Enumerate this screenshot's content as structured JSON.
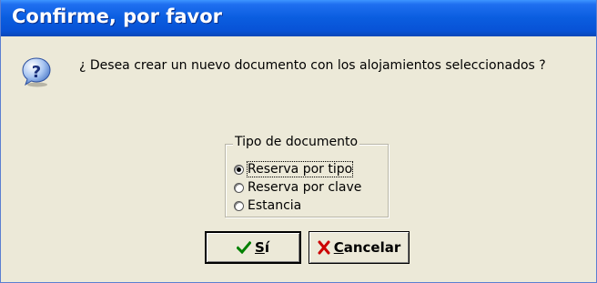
{
  "dialog": {
    "title": "Confirme, por favor",
    "icon": "question-icon",
    "message": "¿ Desea crear un nuevo documento con los alojamientos seleccionados ?"
  },
  "document_type": {
    "legend": "Tipo de documento",
    "options": [
      {
        "label": "Reserva por tipo",
        "selected": true
      },
      {
        "label": "Reserva por clave",
        "selected": false
      },
      {
        "label": "Estancia",
        "selected": false
      }
    ]
  },
  "buttons": {
    "ok": {
      "hotkey": "S",
      "rest": "í",
      "icon": "checkmark-icon",
      "color": "#008000"
    },
    "cancel": {
      "hotkey": "C",
      "rest": "ancelar",
      "icon": "x-icon",
      "color": "#cc0000"
    }
  },
  "colors": {
    "titlebar": "#0a5ddf",
    "dialog_bg": "#ece9d8"
  }
}
